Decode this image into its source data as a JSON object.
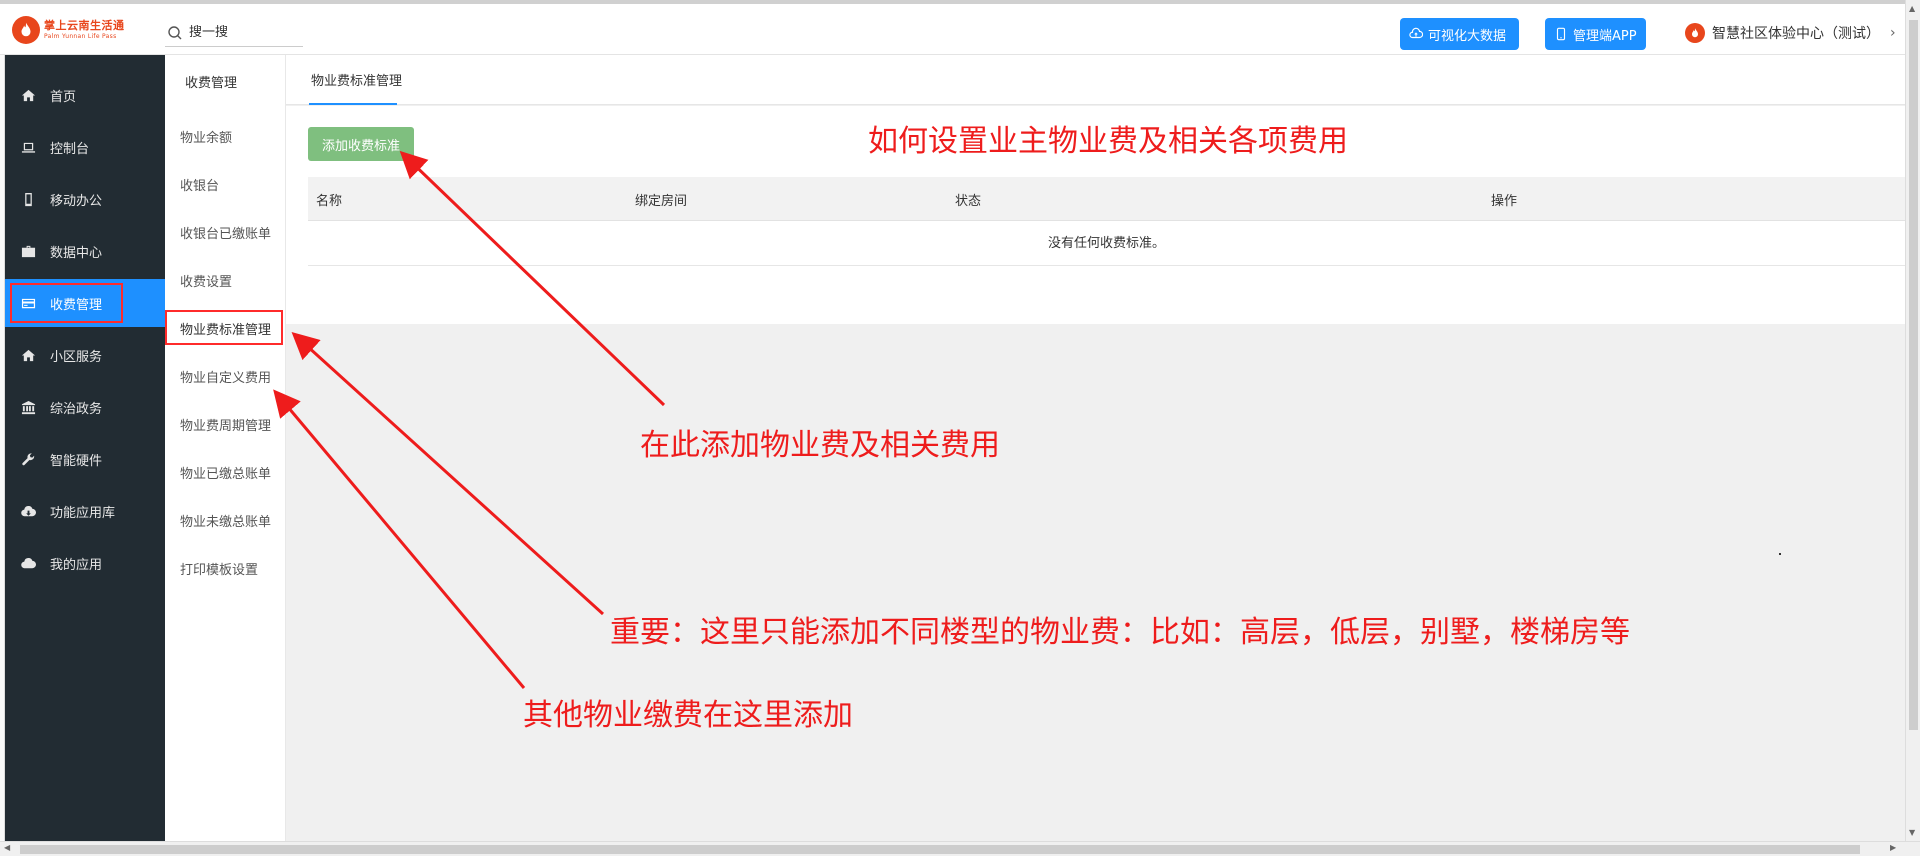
{
  "brand": {
    "name_cn": "掌上云南生活通",
    "name_en": "Palm Yunnan Life Pass",
    "accent": "#e8461c"
  },
  "search": {
    "placeholder": "搜一搜"
  },
  "header": {
    "big_data_label": "可视化大数据",
    "mgmt_app_label": "管理端APP",
    "community_label": "智慧社区体验中心（测试）",
    "button_color": "#1e90ff"
  },
  "sidebar": {
    "items": [
      {
        "label": "首页",
        "icon": "home-icon"
      },
      {
        "label": "控制台",
        "icon": "laptop-icon"
      },
      {
        "label": "移动办公",
        "icon": "mobile-icon"
      },
      {
        "label": "数据中心",
        "icon": "briefcase-icon"
      },
      {
        "label": "收费管理",
        "icon": "credit-card-icon",
        "active": true
      },
      {
        "label": "小区服务",
        "icon": "home-icon"
      },
      {
        "label": "综治政务",
        "icon": "bank-icon"
      },
      {
        "label": "智能硬件",
        "icon": "wrench-icon"
      },
      {
        "label": "功能应用库",
        "icon": "cloud-download-icon"
      },
      {
        "label": "我的应用",
        "icon": "cloud-icon"
      }
    ]
  },
  "subnav": {
    "title": "收费管理",
    "items": [
      {
        "label": "物业余额"
      },
      {
        "label": "收银台"
      },
      {
        "label": "收银台已缴账单"
      },
      {
        "label": "收费设置"
      },
      {
        "label": "物业费标准管理",
        "active": true
      },
      {
        "label": "物业自定义费用"
      },
      {
        "label": "物业费周期管理"
      },
      {
        "label": "物业已缴总账单"
      },
      {
        "label": "物业未缴总账单"
      },
      {
        "label": "打印模板设置"
      }
    ]
  },
  "main": {
    "tab_label": "物业费标准管理",
    "add_button_label": "添加收费标准",
    "table": {
      "headers": [
        "名称",
        "绑定房间",
        "状态",
        "操作"
      ],
      "empty_text": "没有任何收费标准。"
    }
  },
  "annotations": {
    "title": "如何设置业主物业费及相关各项费用",
    "note_add": "在此添加物业费及相关费用",
    "note_important": "重要：这里只能添加不同楼型的物业费：比如：高层，低层，别墅，楼梯房等",
    "note_other": "其他物业缴费在这里添加",
    "color": "#ee1c1c"
  }
}
